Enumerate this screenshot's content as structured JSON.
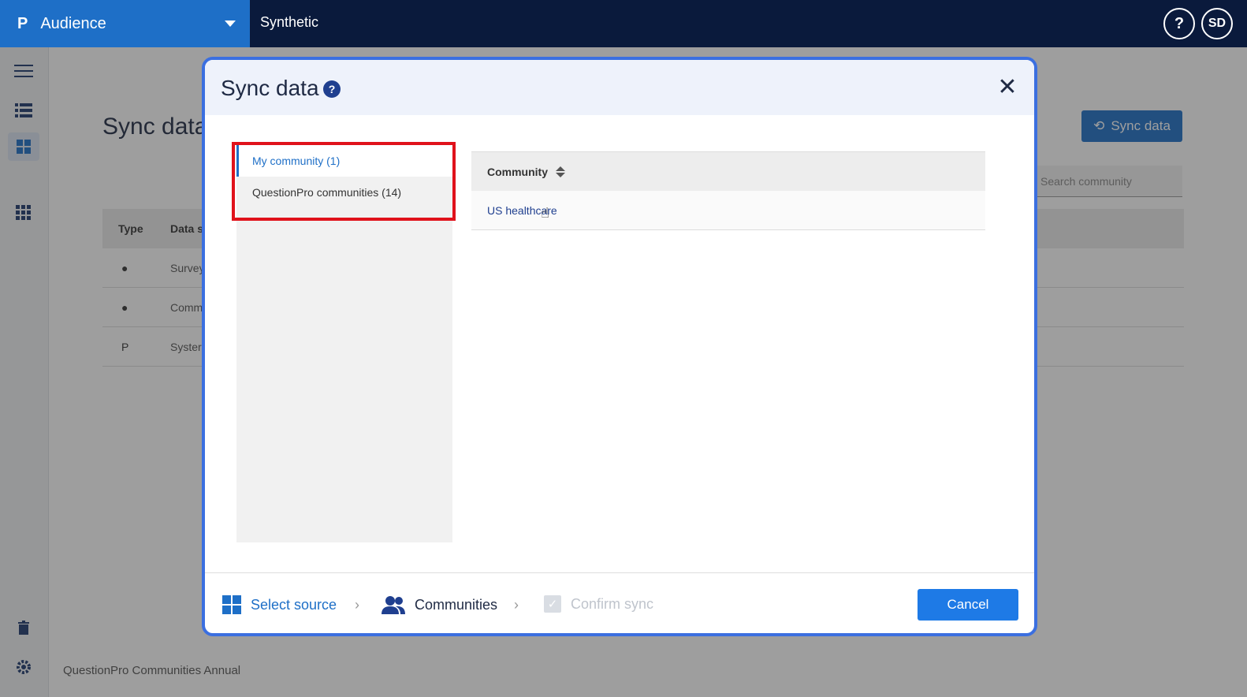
{
  "topbar": {
    "logo": "P",
    "app_name": "Audience",
    "workspace": "Synthetic",
    "help": "?",
    "avatar_initials": "SD"
  },
  "sidebar": {
    "items": [
      {
        "icon": "menu-icon"
      },
      {
        "icon": "list-icon"
      },
      {
        "icon": "dashboard-icon",
        "active": true
      },
      {
        "icon": "apps-grid-icon"
      },
      {
        "icon": "trash-icon"
      },
      {
        "icon": "gear-icon"
      }
    ]
  },
  "page": {
    "title": "Sync data",
    "sync_button": "Sync data",
    "search_placeholder": "Search community",
    "table": {
      "headers": [
        "Type",
        "Data s"
      ],
      "rows": [
        {
          "icon": "person-icon",
          "text": "Survey"
        },
        {
          "icon": "person-icon",
          "text": "Comm"
        },
        {
          "icon": "questionpro-icon",
          "text": "Syster"
        }
      ]
    },
    "footer_text": "QuestionPro Communities Annual"
  },
  "modal": {
    "title": "Sync data",
    "tabs": [
      {
        "label": "My community (1)",
        "active": true
      },
      {
        "label": "QuestionPro communities (14)",
        "active": false
      }
    ],
    "table": {
      "header": "Community",
      "rows": [
        "US healthcare"
      ]
    },
    "steps": [
      {
        "label": "Select source",
        "state": "done"
      },
      {
        "label": "Communities",
        "state": "current"
      },
      {
        "label": "Confirm sync",
        "state": "pending"
      }
    ],
    "cancel_label": "Cancel"
  },
  "colors": {
    "brand": "#1e6fc7",
    "topbar": "#0a1a3c",
    "highlight": "#e0121b",
    "modal_border": "#3b6fe0"
  }
}
